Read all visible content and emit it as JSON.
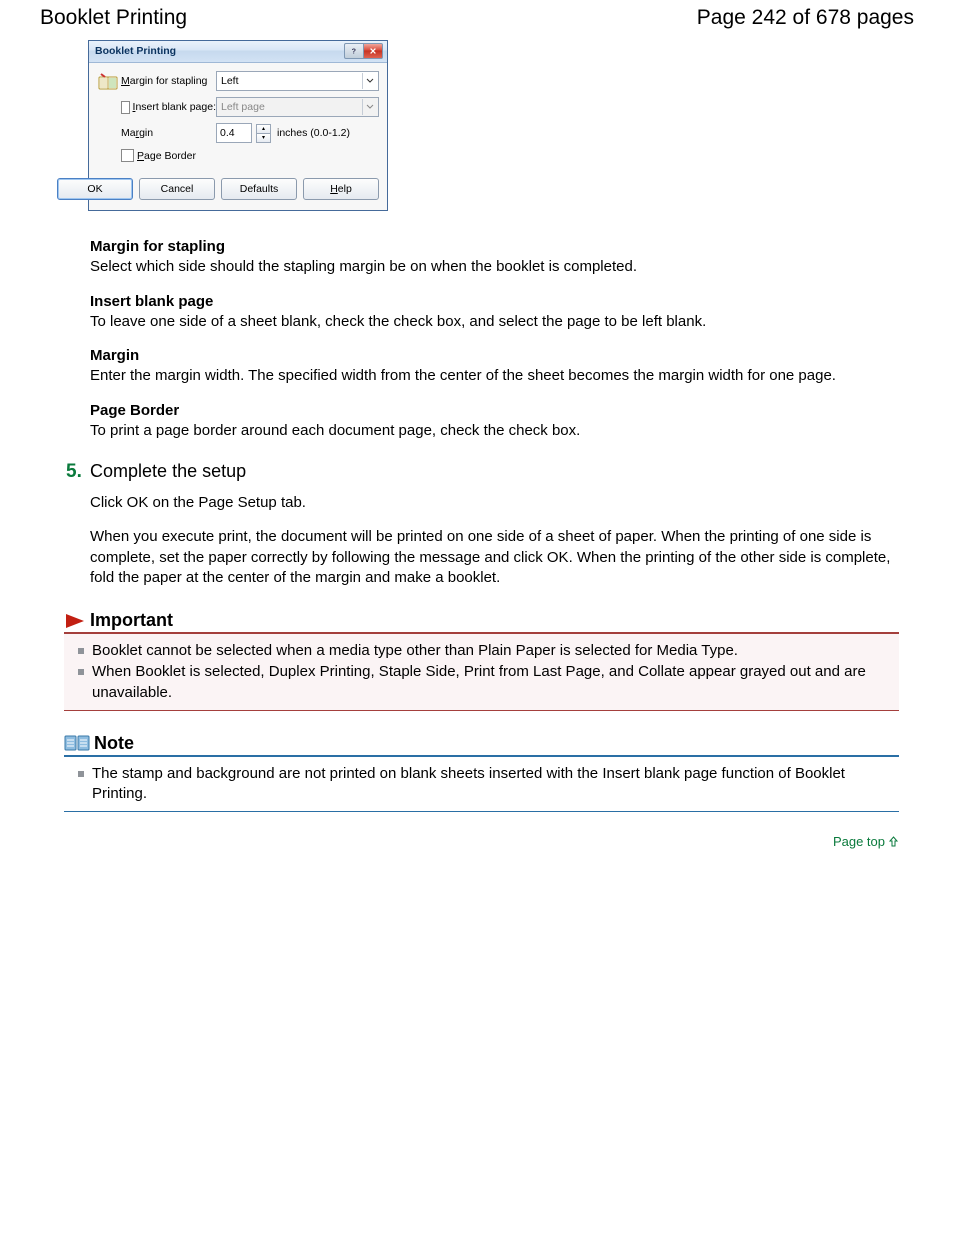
{
  "header": {
    "title": "Booklet Printing",
    "pageinfo": "Page 242 of 678 pages"
  },
  "dialog": {
    "title": "Booklet Printing",
    "rows": {
      "margin_stapling_label": "Margin for stapling",
      "margin_stapling_value": "Left",
      "insert_blank_label": "Insert blank page:",
      "insert_blank_value": "Left page",
      "margin_label": "Margin",
      "margin_value": "0.4",
      "margin_unit": "inches (0.0-1.2)",
      "page_border_label": "Page Border"
    },
    "buttons": {
      "ok": "OK",
      "cancel": "Cancel",
      "defaults": "Defaults",
      "help": "Help"
    }
  },
  "fields": [
    {
      "title": "Margin for stapling",
      "desc": "Select which side should the stapling margin be on when the booklet is completed."
    },
    {
      "title": "Insert blank page",
      "desc": "To leave one side of a sheet blank, check the check box, and select the page to be left blank."
    },
    {
      "title": "Margin",
      "desc": "Enter the margin width. The specified width from the center of the sheet becomes the margin width for one page."
    },
    {
      "title": "Page Border",
      "desc": "To print a page border around each document page, check the check box."
    }
  ],
  "step": {
    "num": "5.",
    "title": "Complete the setup",
    "line1": "Click OK on the Page Setup tab.",
    "line2": "When you execute print, the document will be printed on one side of a sheet of paper. When the printing of one side is complete, set the paper correctly by following the message and click OK. When the printing of the other side is complete, fold the paper at the center of the margin and make a booklet."
  },
  "important": {
    "heading": "Important",
    "items": [
      "Booklet cannot be selected when a media type other than Plain Paper is selected for Media Type.",
      "When Booklet is selected, Duplex Printing, Staple Side, Print from Last Page, and Collate appear grayed out and are unavailable."
    ]
  },
  "note": {
    "heading": "Note",
    "items": [
      "The stamp and background are not printed on blank sheets inserted with the Insert blank page function of Booklet Printing."
    ]
  },
  "pagetop": "Page top"
}
